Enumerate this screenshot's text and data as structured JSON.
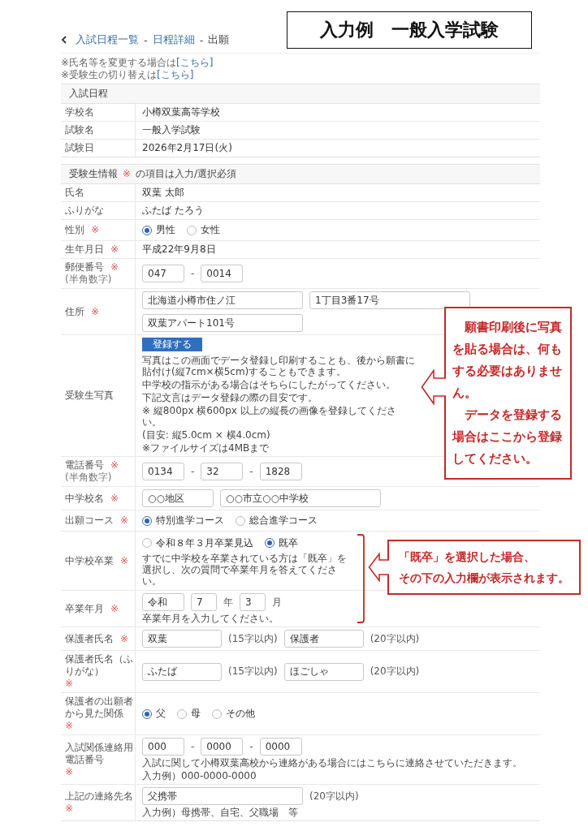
{
  "title_box": "入力例　一般入学試験",
  "breadcrumb": [
    {
      "kind": "link",
      "text": "入試日程一覧"
    },
    {
      "kind": "separator",
      "text": "-"
    },
    {
      "kind": "link",
      "text": "日程詳細"
    },
    {
      "kind": "separator",
      "text": "-"
    },
    {
      "kind": "current",
      "text": "出願"
    }
  ],
  "notes": [
    {
      "text": "※氏名等を変更する場合は",
      "link": "[こちら]"
    },
    {
      "text": "※受験生の切り替えは",
      "link": "[こちら]"
    }
  ],
  "schedule": {
    "heading": "入試日程",
    "rows": [
      {
        "label": "学校名",
        "value": "小樽双葉高等学校"
      },
      {
        "label": "試験名",
        "value": "一般入学試験"
      },
      {
        "label": "試験日",
        "value": "2026年2月17日(火)"
      }
    ]
  },
  "applicant": {
    "heading": "受験生情報",
    "required_mark": "※",
    "heading_note": "の項目は入力/選択必須",
    "rows": [
      {
        "label": "氏名",
        "required": false,
        "kind": "text",
        "value": "双葉 太郎"
      },
      {
        "label": "ふりがな",
        "required": false,
        "kind": "text",
        "value": "ふたば たろう"
      },
      {
        "label": "性別",
        "required": true,
        "kind": "radio",
        "options": [
          {
            "label": "男性",
            "selected": true
          },
          {
            "label": "女性",
            "selected": false
          }
        ]
      },
      {
        "label": "生年月日",
        "required": true,
        "kind": "text",
        "value": "平成22年9月8日"
      },
      {
        "label": "郵便番号",
        "required": true,
        "sublabel": "(半角数字)",
        "kind": "fields",
        "lines": [
          [
            {
              "kind": "short",
              "value": "047"
            },
            {
              "kind": "text",
              "text": "-"
            },
            {
              "kind": "short",
              "value": "0014"
            }
          ]
        ]
      },
      {
        "label": "住所",
        "required": true,
        "kind": "fields",
        "lines": [
          [
            {
              "kind": "long",
              "value": "北海道小樽市住ノ江"
            },
            {
              "kind": "long",
              "value": "1丁目3番17号"
            }
          ],
          [
            {
              "kind": "long",
              "value": "双葉アパート101号"
            }
          ]
        ]
      },
      {
        "label": "受験生写真",
        "required": false,
        "kind": "photo",
        "button": "登録する",
        "help": [
          "写真はこの画面でデータ登録し印刷することも、後から願書に貼付け(縦7cm×横5cm)することもできます。",
          "中学校の指示がある場合はそちらにしたがってください。",
          "下記文言はデータ登録の際の目安です。",
          "※ 縦800px 横600px 以上の縦長の画像を登録してください。",
          "(目安: 縦5.0cm × 横4.0cm)",
          "※ファイルサイズは4MBまで"
        ],
        "annotation": {
          "kind": "callout",
          "lines": [
            "願書印刷後に写真を貼る場合は、何もする必要はありません。",
            "データを登録する場合はここから登録してください。"
          ]
        }
      },
      {
        "label": "電話番号",
        "required": true,
        "sublabel": "(半角数字)",
        "kind": "fields",
        "lines": [
          [
            {
              "kind": "short",
              "value": "0134"
            },
            {
              "kind": "text",
              "text": "-"
            },
            {
              "kind": "short",
              "value": "32"
            },
            {
              "kind": "text",
              "text": "-"
            },
            {
              "kind": "short",
              "value": "1828"
            }
          ]
        ]
      },
      {
        "label": "中学校名",
        "required": true,
        "kind": "fields",
        "lines": [
          [
            {
              "kind": "medium",
              "value": "○○地区"
            },
            {
              "kind": "long",
              "value": "○○市立○○中学校"
            }
          ]
        ]
      },
      {
        "label": "出願コース",
        "required": true,
        "kind": "radio",
        "options": [
          {
            "label": "特別進学コース",
            "selected": true
          },
          {
            "label": "総合進学コース",
            "selected": false
          }
        ]
      },
      {
        "label": "中学校卒業",
        "required": true,
        "kind": "radio",
        "options": [
          {
            "label": "令和８年３月卒業見込",
            "selected": false
          },
          {
            "label": "既卒",
            "selected": true
          }
        ],
        "help": [
          "すでに中学校を卒業されている方は「既卒」を選択し、次の質問で卒業年月を答えてください。"
        ],
        "annotation": {
          "kind": "bracket",
          "lines": [
            "「既卒」を選択した場合、",
            "その下の入力欄が表示されます。"
          ]
        }
      },
      {
        "label": "卒業年月",
        "required": true,
        "kind": "fields",
        "lines": [
          [
            {
              "kind": "short",
              "value": "令和"
            },
            {
              "kind": "tiny",
              "value": "7"
            },
            {
              "kind": "text",
              "text": "年"
            },
            {
              "kind": "tiny",
              "value": "3"
            },
            {
              "kind": "text",
              "text": "月"
            }
          ]
        ],
        "help": [
          "卒業年月を入力してください。"
        ]
      },
      {
        "label": "保護者氏名",
        "required": true,
        "kind": "fields",
        "lines": [
          [
            {
              "kind": "name",
              "value": "双葉"
            },
            {
              "kind": "text",
              "text": "(15字以内)"
            },
            {
              "kind": "name",
              "value": "保護者"
            },
            {
              "kind": "text",
              "text": "(20字以内)"
            }
          ]
        ]
      },
      {
        "label": "保護者氏名（ふりがな）",
        "required": true,
        "kind": "fields",
        "lines": [
          [
            {
              "kind": "name",
              "value": "ふたば"
            },
            {
              "kind": "text",
              "text": "(15字以内)"
            },
            {
              "kind": "name",
              "value": "ほごしゃ"
            },
            {
              "kind": "text",
              "text": "(20字以内)"
            }
          ]
        ]
      },
      {
        "label": "保護者の出願者から見た関係",
        "required": true,
        "kind": "radio",
        "options": [
          {
            "label": "父",
            "selected": true
          },
          {
            "label": "母",
            "selected": false
          },
          {
            "label": "その他",
            "selected": false
          }
        ]
      },
      {
        "label": "入試関係連絡用電話番号",
        "required": true,
        "kind": "fields",
        "lines": [
          [
            {
              "kind": "short",
              "value": "000"
            },
            {
              "kind": "text",
              "text": "-"
            },
            {
              "kind": "short",
              "value": "0000"
            },
            {
              "kind": "text",
              "text": "-"
            },
            {
              "kind": "short",
              "value": "0000"
            }
          ]
        ],
        "help": [
          "入試に関して小樽双葉高校から連絡がある場合にはこちらに連絡させていただきます。",
          "入力例）000-0000-0000"
        ]
      },
      {
        "label": "上記の連絡先名",
        "required": true,
        "kind": "fields",
        "lines": [
          [
            {
              "kind": "long",
              "value": "父携帯"
            },
            {
              "kind": "text",
              "text": "(20字以内)"
            }
          ]
        ],
        "help": [
          "入力例）母携帯、自宅、父職場　等"
        ]
      }
    ]
  }
}
